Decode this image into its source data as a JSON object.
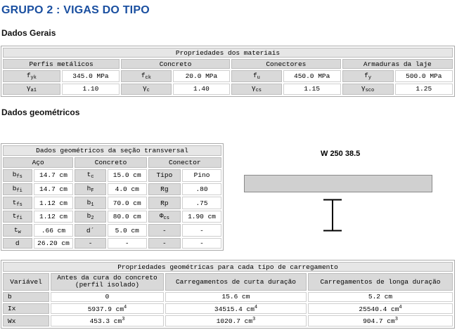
{
  "title": "GRUPO 2 : VIGAS DO TIPO",
  "section_gerais": "Dados Gerais",
  "section_geom": "Dados geométricos",
  "materials": {
    "caption": "Propriedades dos materiais",
    "groups": [
      "Perfis metálicos",
      "Concreto",
      "Conectores",
      "Armaduras da laje"
    ],
    "row1": [
      {
        "sym": "f",
        "sub": "yk",
        "val": "345.0 MPa"
      },
      {
        "sym": "f",
        "sub": "ck",
        "val": "20.0 MPa"
      },
      {
        "sym": "f",
        "sub": "u",
        "val": "450.0 MPa"
      },
      {
        "sym": "f",
        "sub": "y",
        "val": "500.0 MPa"
      }
    ],
    "row2": [
      {
        "sym": "γ",
        "sub": "a1",
        "val": "1.10"
      },
      {
        "sym": "γ",
        "sub": "c",
        "val": "1.40"
      },
      {
        "sym": "γ",
        "sub": "cs",
        "val": "1.15"
      },
      {
        "sym": "γ",
        "sub": "sco",
        "val": "1.25"
      }
    ]
  },
  "geom": {
    "caption": "Dados geométricos da seção transversal",
    "groups": [
      "Aço",
      "Concreto",
      "Conector"
    ],
    "rows": [
      [
        "b",
        "fs",
        "14.7 cm",
        "t",
        "c",
        "15.0 cm",
        "Tipo",
        "",
        "Pino"
      ],
      [
        "b",
        "fi",
        "14.7 cm",
        "h",
        "F",
        "4.0 cm",
        "Rg",
        "",
        ".80"
      ],
      [
        "t",
        "fs",
        "1.12 cm",
        "b",
        "1",
        "70.0 cm",
        "Rp",
        "",
        ".75"
      ],
      [
        "t",
        "fi",
        "1.12 cm",
        "b",
        "2",
        "80.0 cm",
        "Φ",
        "cs",
        "1.90 cm"
      ],
      [
        "t",
        "w",
        ".66 cm",
        "d´",
        "",
        "5.0 cm",
        "-",
        "",
        "-"
      ],
      [
        "d",
        "",
        "26.20 cm",
        "-",
        "",
        "-",
        "-",
        "",
        "-"
      ]
    ]
  },
  "section_label": "W 250 38.5",
  "loads": {
    "caption": "Propriedades geométricas para cada tipo de carregamento",
    "headers": [
      "Variável",
      "Antes da cura do concreto (perfil isolado)",
      "Carregamentos de curta duração",
      "Carregamentos de longa duração"
    ],
    "rows": [
      {
        "var": "b",
        "v1": "0",
        "v2": "15.6 cm",
        "v3": "5.2 cm",
        "unit_sup": ""
      },
      {
        "var": "Ix",
        "v1": "5937.9 cm",
        "v2": "34515.4 cm",
        "v3": "25540.4 cm",
        "unit_sup": "4"
      },
      {
        "var": "Wx",
        "v1": "453.3 cm",
        "v2": "1020.7 cm",
        "v3": "904.7 cm",
        "unit_sup": "3"
      }
    ]
  }
}
